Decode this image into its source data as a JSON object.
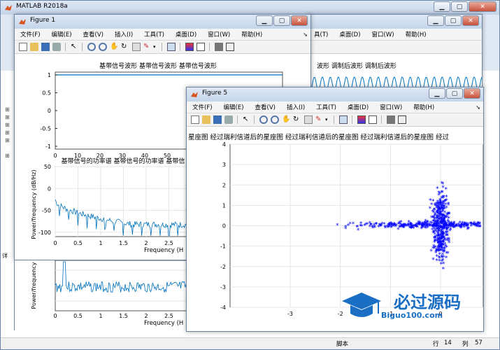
{
  "main_window": {
    "title": "MATLAB R2018a",
    "right_tab_text": "录",
    "menu_items": [
      "文件(F)",
      "编辑(E)",
      "查看(V)",
      "插入(I)",
      "工具(T)",
      "桌面(D)",
      "窗口(W)",
      "帮助(H)"
    ]
  },
  "figure1": {
    "title": "Figure 1",
    "menu": [
      "文件(F)",
      "编辑(E)",
      "查看(V)",
      "插入(I)",
      "工具(T)",
      "桌面(D)",
      "窗口(W)",
      "帮助(H)"
    ],
    "plot1": {
      "title": "基带信号波形 基带信号波形 基带信号波形",
      "yticks": [
        "1",
        "0.5",
        "0",
        "-0.5",
        "-1"
      ],
      "xticks": [
        "0",
        "10",
        "20",
        "30",
        "40",
        "50"
      ]
    },
    "plot2": {
      "title": "基带信号的功率谱 基带信号的功率谱 基带信",
      "ylabel": "Power/frequency (dB/Hz)",
      "xlabel": "Frequency (H",
      "yticks": [
        "50",
        "0",
        "-50",
        "-100"
      ],
      "xticks": [
        "0",
        "0.5",
        "1",
        "1.5",
        "2",
        "2.5"
      ]
    },
    "plot3": {
      "ylabel": "Power/frequency",
      "xlabel": "Frequency (H",
      "xticks": [
        "0",
        "0.5",
        "1",
        "1.5",
        "2",
        "2.5"
      ]
    },
    "left_label": "详"
  },
  "figure_back": {
    "menu": [
      "具(T)",
      "桌面(D)",
      "窗口(W)",
      "帮助(H)"
    ],
    "plot_title": "波形 调制后波形 调制后波形"
  },
  "figure5": {
    "title": "Figure 5",
    "menu": [
      "文件(F)",
      "编辑(E)",
      "查看(V)",
      "插入(I)",
      "工具(T)",
      "桌面(D)",
      "窗口(W)",
      "帮助(H)"
    ],
    "plot_title": "星座图 经过瑞利信道后的星座图 经过瑞利信道后的星座图 经过瑞利信道后的星座图 经过",
    "yticks": [
      "4",
      "3",
      "2",
      "1",
      "0",
      "-1",
      "-2",
      "-3",
      "-4"
    ],
    "xticks": [
      "-3",
      "-2",
      "-1",
      "0"
    ]
  },
  "chart_data": [
    {
      "type": "line",
      "title": "基带信号波形 基带信号波形 基带信号波形",
      "x_range": [
        0,
        55
      ],
      "ylim": [
        -1.2,
        1.2
      ],
      "series": [
        {
          "values": [
            1,
            1
          ]
        }
      ]
    },
    {
      "type": "line",
      "title": "基带信号的功率谱 基带信号的功率谱 基带信",
      "xlabel": "Frequency (H",
      "ylabel": "Power/frequency (dB/Hz)",
      "xlim": [
        0,
        2.7
      ],
      "ylim": [
        -110,
        50
      ],
      "series": [
        {
          "values": [
            -25,
            -60,
            -70,
            -75
          ]
        }
      ]
    },
    {
      "type": "scatter",
      "title": "星座图 经过瑞利信道后的星座图 经过瑞利信道后的星座图 经过瑞利信道后的星座图 经过",
      "xlim": [
        -4,
        0.5
      ],
      "ylim": [
        -4,
        4
      ],
      "grid": true,
      "marker": "*",
      "shape": "cross centered at (0,0), arms reaching about ±3.6"
    }
  ],
  "status": {
    "script_label": "脚本",
    "line_label": "行",
    "line_value": "14",
    "col_label": "列",
    "col_value": "57"
  },
  "watermark": {
    "text": "必过源码",
    "url": "Biguo100.com"
  },
  "colors": {
    "plot_blue": "#0072bd",
    "scatter_blue": "#0000ff",
    "title_bar": "#c4d5ea"
  }
}
